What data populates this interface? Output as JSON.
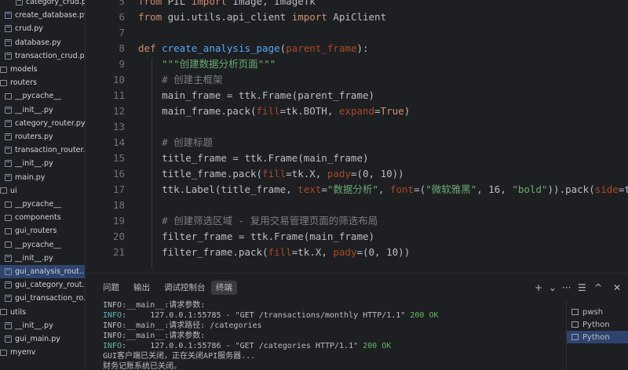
{
  "sidebar": {
    "items": [
      {
        "label": "category_crud.py",
        "kind": "py"
      },
      {
        "label": "create_database.py",
        "kind": "py"
      },
      {
        "label": "crud.py",
        "kind": "py"
      },
      {
        "label": "database.py",
        "kind": "py"
      },
      {
        "label": "transaction_crud.py",
        "kind": "py"
      },
      {
        "label": "models",
        "kind": "folder"
      },
      {
        "label": "routers",
        "kind": "folder"
      },
      {
        "label": "__pycache__",
        "kind": "folder"
      },
      {
        "label": "__init__.py",
        "kind": "py"
      },
      {
        "label": "category_router.py",
        "kind": "py"
      },
      {
        "label": "routers.py",
        "kind": "py"
      },
      {
        "label": "transaction_router...",
        "kind": "py"
      },
      {
        "label": "__init__.py",
        "kind": "py"
      },
      {
        "label": "main.py",
        "kind": "py"
      },
      {
        "label": "ui",
        "kind": "folder"
      },
      {
        "label": "__pycache__",
        "kind": "folder"
      },
      {
        "label": "components",
        "kind": "folder"
      },
      {
        "label": "gui_routers",
        "kind": "folder"
      },
      {
        "label": "__pycache__",
        "kind": "folder"
      },
      {
        "label": "__init__.py",
        "kind": "py"
      },
      {
        "label": "gui_analysis_rout...",
        "kind": "py",
        "active": true
      },
      {
        "label": "gui_category_rout...",
        "kind": "py"
      },
      {
        "label": "gui_transaction_ro...",
        "kind": "py"
      },
      {
        "label": "utils",
        "kind": "folder"
      },
      {
        "label": "__init__.py",
        "kind": "py"
      },
      {
        "label": "gui_main.py",
        "kind": "py"
      },
      {
        "label": "myenv",
        "kind": "folder"
      }
    ]
  },
  "editor": {
    "lines": [
      {
        "n": "5",
        "parts": [
          [
            "kw",
            "from "
          ],
          [
            "",
            "PIL "
          ],
          [
            "kw",
            "import "
          ],
          [
            "",
            "Image, ImageTk"
          ]
        ]
      },
      {
        "n": "6",
        "parts": [
          [
            "kw",
            "from "
          ],
          [
            "",
            "gui.utils.api_client "
          ],
          [
            "kw",
            "import "
          ],
          [
            "",
            "ApiClient"
          ]
        ]
      },
      {
        "n": "7",
        "parts": []
      },
      {
        "n": "8",
        "parts": [
          [
            "kw",
            "def "
          ],
          [
            "fn",
            "create_analysis_page"
          ],
          [
            "",
            "("
          ],
          [
            "pm",
            "parent_frame"
          ],
          [
            "",
            "):"
          ]
        ]
      },
      {
        "n": "9",
        "parts": [
          [
            "st",
            "    \"\"\"创建数据分析页面\"\"\""
          ]
        ]
      },
      {
        "n": "10",
        "parts": [
          [
            "cm",
            "    # 创建主框架"
          ]
        ]
      },
      {
        "n": "11",
        "parts": [
          [
            "",
            "    main_frame = ttk.Frame(parent_frame)"
          ]
        ]
      },
      {
        "n": "12",
        "parts": [
          [
            "",
            "    main_frame.pack("
          ],
          [
            "pm",
            "fill"
          ],
          [
            "",
            "=tk.BOTH, "
          ],
          [
            "pm",
            "expand"
          ],
          [
            "",
            "="
          ],
          [
            "kw",
            "True"
          ],
          [
            "",
            ")"
          ]
        ]
      },
      {
        "n": "13",
        "parts": []
      },
      {
        "n": "14",
        "parts": [
          [
            "cm",
            "    # 创建标题"
          ]
        ]
      },
      {
        "n": "15",
        "parts": [
          [
            "",
            "    title_frame = ttk.Frame(main_frame)"
          ]
        ]
      },
      {
        "n": "16",
        "parts": [
          [
            "",
            "    title_frame.pack("
          ],
          [
            "pm",
            "fill"
          ],
          [
            "",
            "=tk.X, "
          ],
          [
            "pm",
            "pady"
          ],
          [
            "",
            "=(0, 10))"
          ]
        ]
      },
      {
        "n": "17",
        "parts": [
          [
            "",
            "    ttk.Label(title_frame, "
          ],
          [
            "pm",
            "text"
          ],
          [
            "",
            "="
          ],
          [
            "st",
            "\"数据分析\""
          ],
          [
            "",
            ", "
          ],
          [
            "pm",
            "font"
          ],
          [
            "",
            "=("
          ],
          [
            "st",
            "\"微软雅黑\""
          ],
          [
            "",
            ", 16, "
          ],
          [
            "st",
            "\"bold\""
          ],
          [
            "",
            "))."
          ],
          [
            "",
            "pack("
          ],
          [
            "pm",
            "side"
          ],
          [
            "",
            "=tk.LEFT)"
          ]
        ]
      },
      {
        "n": "18",
        "parts": []
      },
      {
        "n": "19",
        "parts": [
          [
            "cm",
            "    # 创建筛选区域 - 复用交易管理页面的筛选布局"
          ]
        ]
      },
      {
        "n": "20",
        "parts": [
          [
            "",
            "    filter_frame = ttk.Frame(main_frame)"
          ]
        ]
      },
      {
        "n": "21",
        "parts": [
          [
            "",
            "    filter_frame.pack("
          ],
          [
            "pm",
            "fill"
          ],
          [
            "",
            "=tk.X, "
          ],
          [
            "pm",
            "pady"
          ],
          [
            "",
            "=(0, 10))"
          ]
        ]
      }
    ]
  },
  "panel": {
    "tabs": [
      {
        "label": "问题"
      },
      {
        "label": "输出"
      },
      {
        "label": "调试控制台"
      },
      {
        "label": "终端",
        "active": true
      }
    ],
    "toolbar_icons": [
      "plus-icon",
      "chevron-down-icon",
      "ellipsis-icon",
      "panel-layout-icon",
      "chevron-up-icon",
      "close-icon"
    ],
    "toolbar_glyphs": [
      "+",
      "⌄",
      "···",
      "☰",
      "^",
      "✕"
    ],
    "terminal_lines": [
      [
        [
          "",
          "INFO:__main__:请求参数:"
        ]
      ],
      [
        [
          "info",
          "INFO"
        ],
        [
          "",
          ":     127.0.0.1:55785 - \"GET /transactions/monthly HTTP/1.1\" "
        ],
        [
          "ok",
          "200 OK"
        ]
      ],
      [
        [
          "",
          "INFO:__main__:请求路径: /categories"
        ]
      ],
      [
        [
          "",
          "INFO:__main__:请求参数:"
        ]
      ],
      [
        [
          "info",
          "INFO"
        ],
        [
          "",
          ":     127.0.0.1:55786 - \"GET /categories HTTP/1.1\" "
        ],
        [
          "ok",
          "200 OK"
        ]
      ],
      [
        [
          "",
          "GUI客户端已关闭，正在关闭API服务器..."
        ]
      ],
      [
        [
          "",
          "财务记账系统已关闭。"
        ]
      ]
    ],
    "terminals": [
      {
        "label": "pwsh"
      },
      {
        "label": "Python"
      },
      {
        "label": "Python",
        "active": true
      }
    ]
  },
  "colors": {
    "background": "#1e1f22",
    "keyword": "#cf8e6d",
    "function": "#56a8f5",
    "string": "#6aab73",
    "comment": "#7a7e85",
    "selection": "#2e436e"
  }
}
